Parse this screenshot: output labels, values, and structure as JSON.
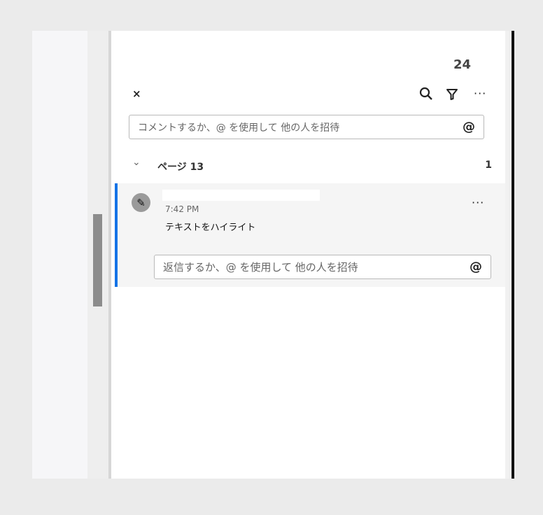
{
  "header": {
    "count": "24",
    "close_label": "×"
  },
  "toolbar": {
    "search": "search",
    "filter": "filter",
    "more": "···"
  },
  "comment_input": {
    "placeholder": "コメントするか、@ を使用して 他の人を招待",
    "at": "@"
  },
  "section": {
    "title": "ページ 13",
    "count": "1",
    "chevron": "⌄"
  },
  "comment": {
    "time": "7:42 PM",
    "text": "テキストをハイライト",
    "more": "···"
  },
  "reply_input": {
    "placeholder": "返信するか、@ を使用して 他の人を招待",
    "at": "@"
  }
}
